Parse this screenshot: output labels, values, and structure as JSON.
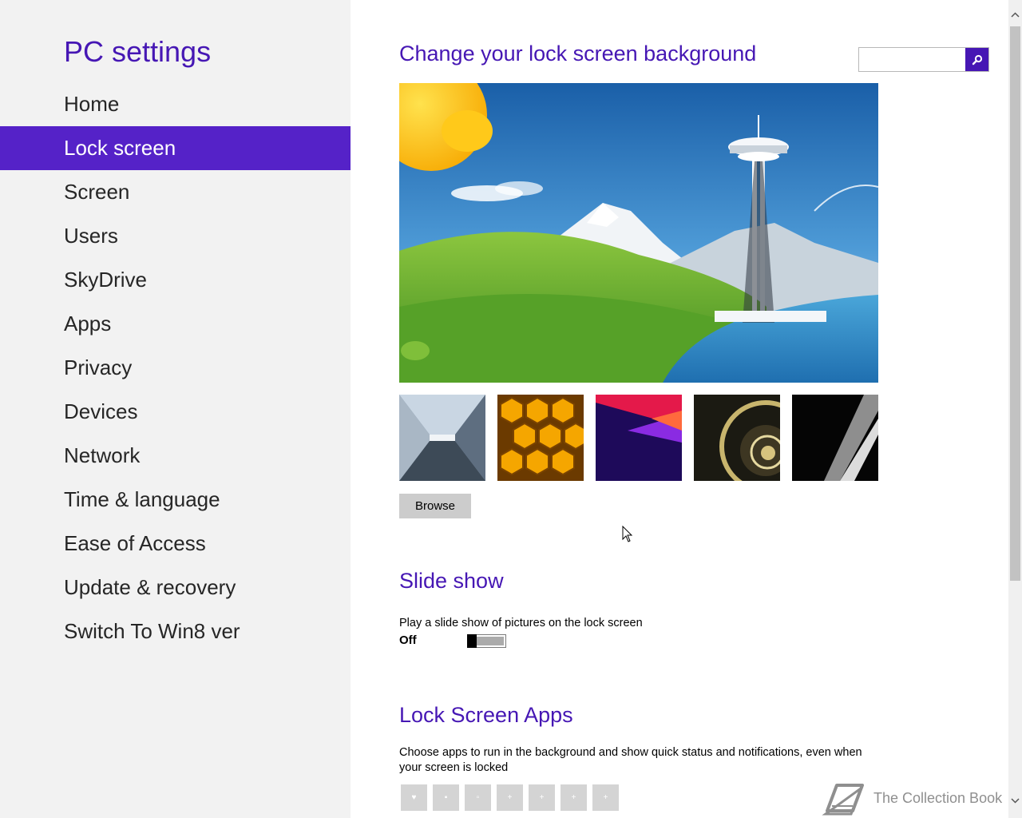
{
  "sidebar": {
    "title": "PC settings",
    "items": [
      {
        "label": "Home",
        "active": false
      },
      {
        "label": "Lock screen",
        "active": true
      },
      {
        "label": "Screen",
        "active": false
      },
      {
        "label": "Users",
        "active": false
      },
      {
        "label": "SkyDrive",
        "active": false
      },
      {
        "label": "Apps",
        "active": false
      },
      {
        "label": "Privacy",
        "active": false
      },
      {
        "label": "Devices",
        "active": false
      },
      {
        "label": "Network",
        "active": false
      },
      {
        "label": "Time & language",
        "active": false
      },
      {
        "label": "Ease of Access",
        "active": false
      },
      {
        "label": "Update & recovery",
        "active": false
      },
      {
        "label": "Switch To Win8 ver",
        "active": false
      }
    ]
  },
  "search": {
    "value": "",
    "icon": "search-icon"
  },
  "background": {
    "heading": "Change your lock screen background",
    "thumbnails": [
      "train-tunnel-thumbnail",
      "honeycomb-thumbnail",
      "abstract-shapes-thumbnail",
      "nautilus-shell-thumbnail",
      "piano-keys-thumbnail"
    ],
    "browse_label": "Browse"
  },
  "slideshow": {
    "heading": "Slide show",
    "description": "Play a slide show of pictures on the lock screen",
    "state": "Off"
  },
  "lock_apps": {
    "heading": "Lock Screen Apps",
    "description": "Choose apps to run in the background and show quick status and notifications, even when your screen is locked",
    "slot_count": 7
  },
  "watermark": {
    "text": "The Collection Book"
  },
  "colors": {
    "accent": "#4617b4",
    "active_nav": "#5522c8",
    "sidebar_bg": "#f2f2f2"
  }
}
